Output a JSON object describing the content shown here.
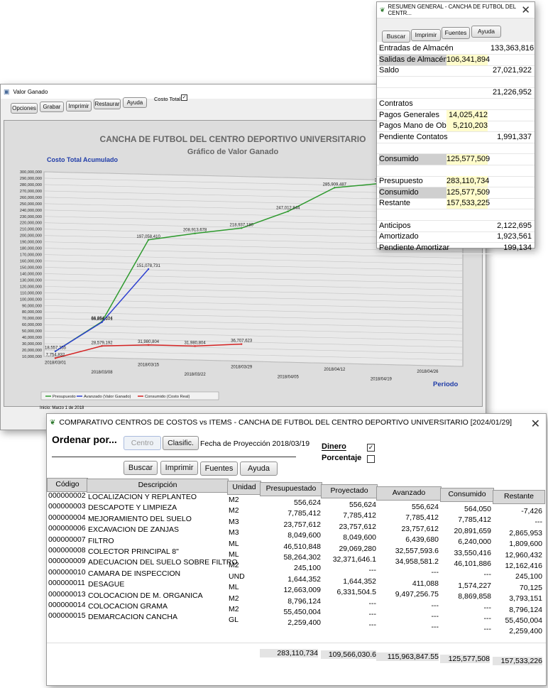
{
  "value_window": {
    "title": "Valor Ganado",
    "buttons": [
      "Opciones",
      "Grabar",
      "Imprimir",
      "Restaurar",
      "Ayuda"
    ],
    "checkbox_label": "Costo Total",
    "footer": "Inicio: Marzo 1 de 2018",
    "chart_data": {
      "type": "line",
      "title": "CANCHA DE FUTBOL DEL CENTRO DEPORTIVO UNIVERSITARIO",
      "subtitle": "Gráfico de Valor Ganado",
      "ylabel": "Costo Total Acumulado",
      "xlabel": "Periodo",
      "ylim": [
        10000000,
        300000000
      ],
      "y_ticks": [
        "300,000,000",
        "290,000,000",
        "280,000,000",
        "270,000,000",
        "260,000,000",
        "250,000,000",
        "240,000,000",
        "230,000,000",
        "220,000,000",
        "210,000,000",
        "200,000,000",
        "190,000,000",
        "180,000,000",
        "170,000,000",
        "160,000,000",
        "150,000,000",
        "140,000,000",
        "130,000,000",
        "120,000,000",
        "110,000,000",
        "100,000,000",
        "90,000,000",
        "80,000,000",
        "70,000,000",
        "60,000,000",
        "50,000,000",
        "40,000,000",
        "30,000,000",
        "20,000,000",
        "10,000,000"
      ],
      "x": [
        "2018/03/01",
        "2018/03/08",
        "2018/03/15",
        "2018/03/22",
        "2018/03/29",
        "2018/04/05",
        "2018/04/12",
        "2018/04/19",
        "2018/04/26"
      ],
      "series": [
        {
          "name": "Presupuesto",
          "color": "#2e9a2e",
          "values": [
            18557255,
            66864614,
            197058410,
            208913678,
            218937180,
            247012844,
            285909487,
            294400000
          ],
          "labels": [
            "18,557,255",
            "66,864,614",
            "197,058,410",
            "208,913,678",
            "218,937,180",
            "247,012,844",
            "285,909,487",
            "294,40"
          ]
        },
        {
          "name": "Avanzado (Valor Ganado)",
          "color": "#2d3fd0",
          "values": [
            18557255,
            65854071,
            151078731
          ],
          "labels": [
            "",
            "66,854,071",
            "151,078,731"
          ]
        },
        {
          "name": "Consumido (Costo Real)",
          "color": "#d42222",
          "values": [
            7754832,
            28579192,
            31980804,
            31980804,
            36707623
          ],
          "labels": [
            "7,754,832",
            "28,579,192",
            "31,980,804",
            "31,980,804",
            "36,707,623"
          ]
        }
      ],
      "legend_position": "bottom-left"
    }
  },
  "resumen": {
    "title": "RESUMEN GENERAL - CANCHA DE FUTBOL DEL CENTR...",
    "buttons": [
      "Buscar",
      "Imprimir",
      "Fuentes",
      "Ayuda"
    ],
    "rows": [
      {
        "label": "Entradas de Almacén",
        "v1": "",
        "v2": "133,363,816"
      },
      {
        "label": "Salidas de Almacén",
        "v1": "106,341,894",
        "v2": ""
      },
      {
        "label": "Saldo",
        "v1": "",
        "v2": "27,021,922"
      },
      {
        "label": "",
        "v1": "",
        "v2": ""
      },
      {
        "label": "",
        "v1": "",
        "v2": "21,226,952"
      },
      {
        "label": "Contratos",
        "v1": "",
        "v2": ""
      },
      {
        "label": "Pagos Generales",
        "v1": "14,025,412",
        "v2": ""
      },
      {
        "label": "Pagos Mano de Obra",
        "v1": "5,210,203",
        "v2": ""
      },
      {
        "label": "Pendiente Contatos",
        "v1": "",
        "v2": "1,991,337"
      },
      {
        "label": "",
        "v1": "",
        "v2": ""
      },
      {
        "label": "Consumido",
        "v1": "125,577,509",
        "v2": ""
      },
      {
        "label": "",
        "v1": "",
        "v2": ""
      },
      {
        "label": "Presupuesto",
        "v1": "283,110,734",
        "v2": ""
      },
      {
        "label": "Consumido",
        "v1": "125,577,509",
        "v2": ""
      },
      {
        "label": "Restante",
        "v1": "157,533,225",
        "v2": ""
      },
      {
        "label": "",
        "v1": "",
        "v2": ""
      },
      {
        "label": "Anticipos",
        "v1": "",
        "v2": "2,122,695"
      },
      {
        "label": "Amortizado",
        "v1": "",
        "v2": "1,923,561"
      },
      {
        "label": "Pendiente Amortizar",
        "v1": "",
        "v2": "199,134"
      }
    ]
  },
  "comparativo": {
    "title": "COMPARATIVO CENTROS DE COSTOS vs ITEMS - CANCHA DE FUTBOL DEL CENTRO DEPORTIVO UNIVERSITARIO [2024/01/29]",
    "order_label": "Ordenar por...",
    "btn_centro": "Centro",
    "btn_clasif": "Clasific.",
    "projection": "Fecha de Proyección 2018/03/19",
    "dinero": "Dinero",
    "porcentaje": "Porcentaje",
    "buttons": [
      "Buscar",
      "Imprimir",
      "Fuentes",
      "Ayuda"
    ],
    "columns": [
      "Código",
      "Descripción",
      "Unidad",
      "Presupuestado",
      "Proyectado",
      "Avanzado",
      "Consumido",
      "Restante"
    ],
    "codes": [
      "000000002",
      "000000003",
      "000000004",
      "000000006",
      "000000007",
      "000000008",
      "000000009",
      "000000010",
      "000000011",
      "000000013",
      "000000014",
      "000000015"
    ],
    "descriptions": [
      "LOCALIZACION Y REPLANTEO",
      "DESCAPOTE Y LIMPIEZA",
      "MEJORAMIENTO DEL SUELO",
      "EXCAVACION DE ZANJAS",
      "FILTRO",
      "COLECTOR PRINCIPAL 8\"",
      "ADECUACION DEL SUELO SOBRE FILTRO",
      "CAMARA DE INSPECCION",
      "DESAGUE",
      "COLOCACION DE M. ORGANICA",
      "COLOCACION GRAMA",
      "DEMARCACION CANCHA"
    ],
    "units": [
      "M2",
      "M2",
      "M3",
      "M3",
      "ML",
      "ML",
      "M2",
      "UND",
      "ML",
      "M2",
      "M2",
      "GL"
    ],
    "presupuestado": [
      "556,624",
      "7,785,412",
      "23,757,612",
      "8,049,600",
      "46,510,848",
      "58,264,302",
      "245,100",
      "1,644,352",
      "12,663,009",
      "8,796,124",
      "55,450,004",
      "2,259,400"
    ],
    "proyectado": [
      "556,624",
      "7,785,412",
      "23,757,612",
      "8,049,600",
      "29,069,280",
      "32,371,646.1",
      "---",
      "1,644,352",
      "6,331,504.5",
      "---",
      "---",
      "---"
    ],
    "avanzado": [
      "556,624",
      "7,785,412",
      "23,757,612",
      "6,439,680",
      "32,557,593.6",
      "34,958,581.2",
      "---",
      "411,088",
      "9,497,256.75",
      "---",
      "---",
      "---"
    ],
    "consumido": [
      "564,050",
      "7,785,412",
      "20,891,659",
      "6,240,000",
      "33,550,416",
      "46,101,886",
      "---",
      "1,574,227",
      "8,869,858",
      "---",
      "---",
      "---"
    ],
    "restante": [
      "-7,426",
      "---",
      "2,865,953",
      "1,809,600",
      "12,960,432",
      "12,162,416",
      "245,100",
      "70,125",
      "3,793,151",
      "8,796,124",
      "55,450,004",
      "2,259,400"
    ],
    "totals": {
      "presupuestado": "283,110,734",
      "proyectado": "109,566,030.6",
      "avanzado": "115,963,847.55",
      "consumido": "125,577,508",
      "restante": "157,533,226"
    }
  }
}
